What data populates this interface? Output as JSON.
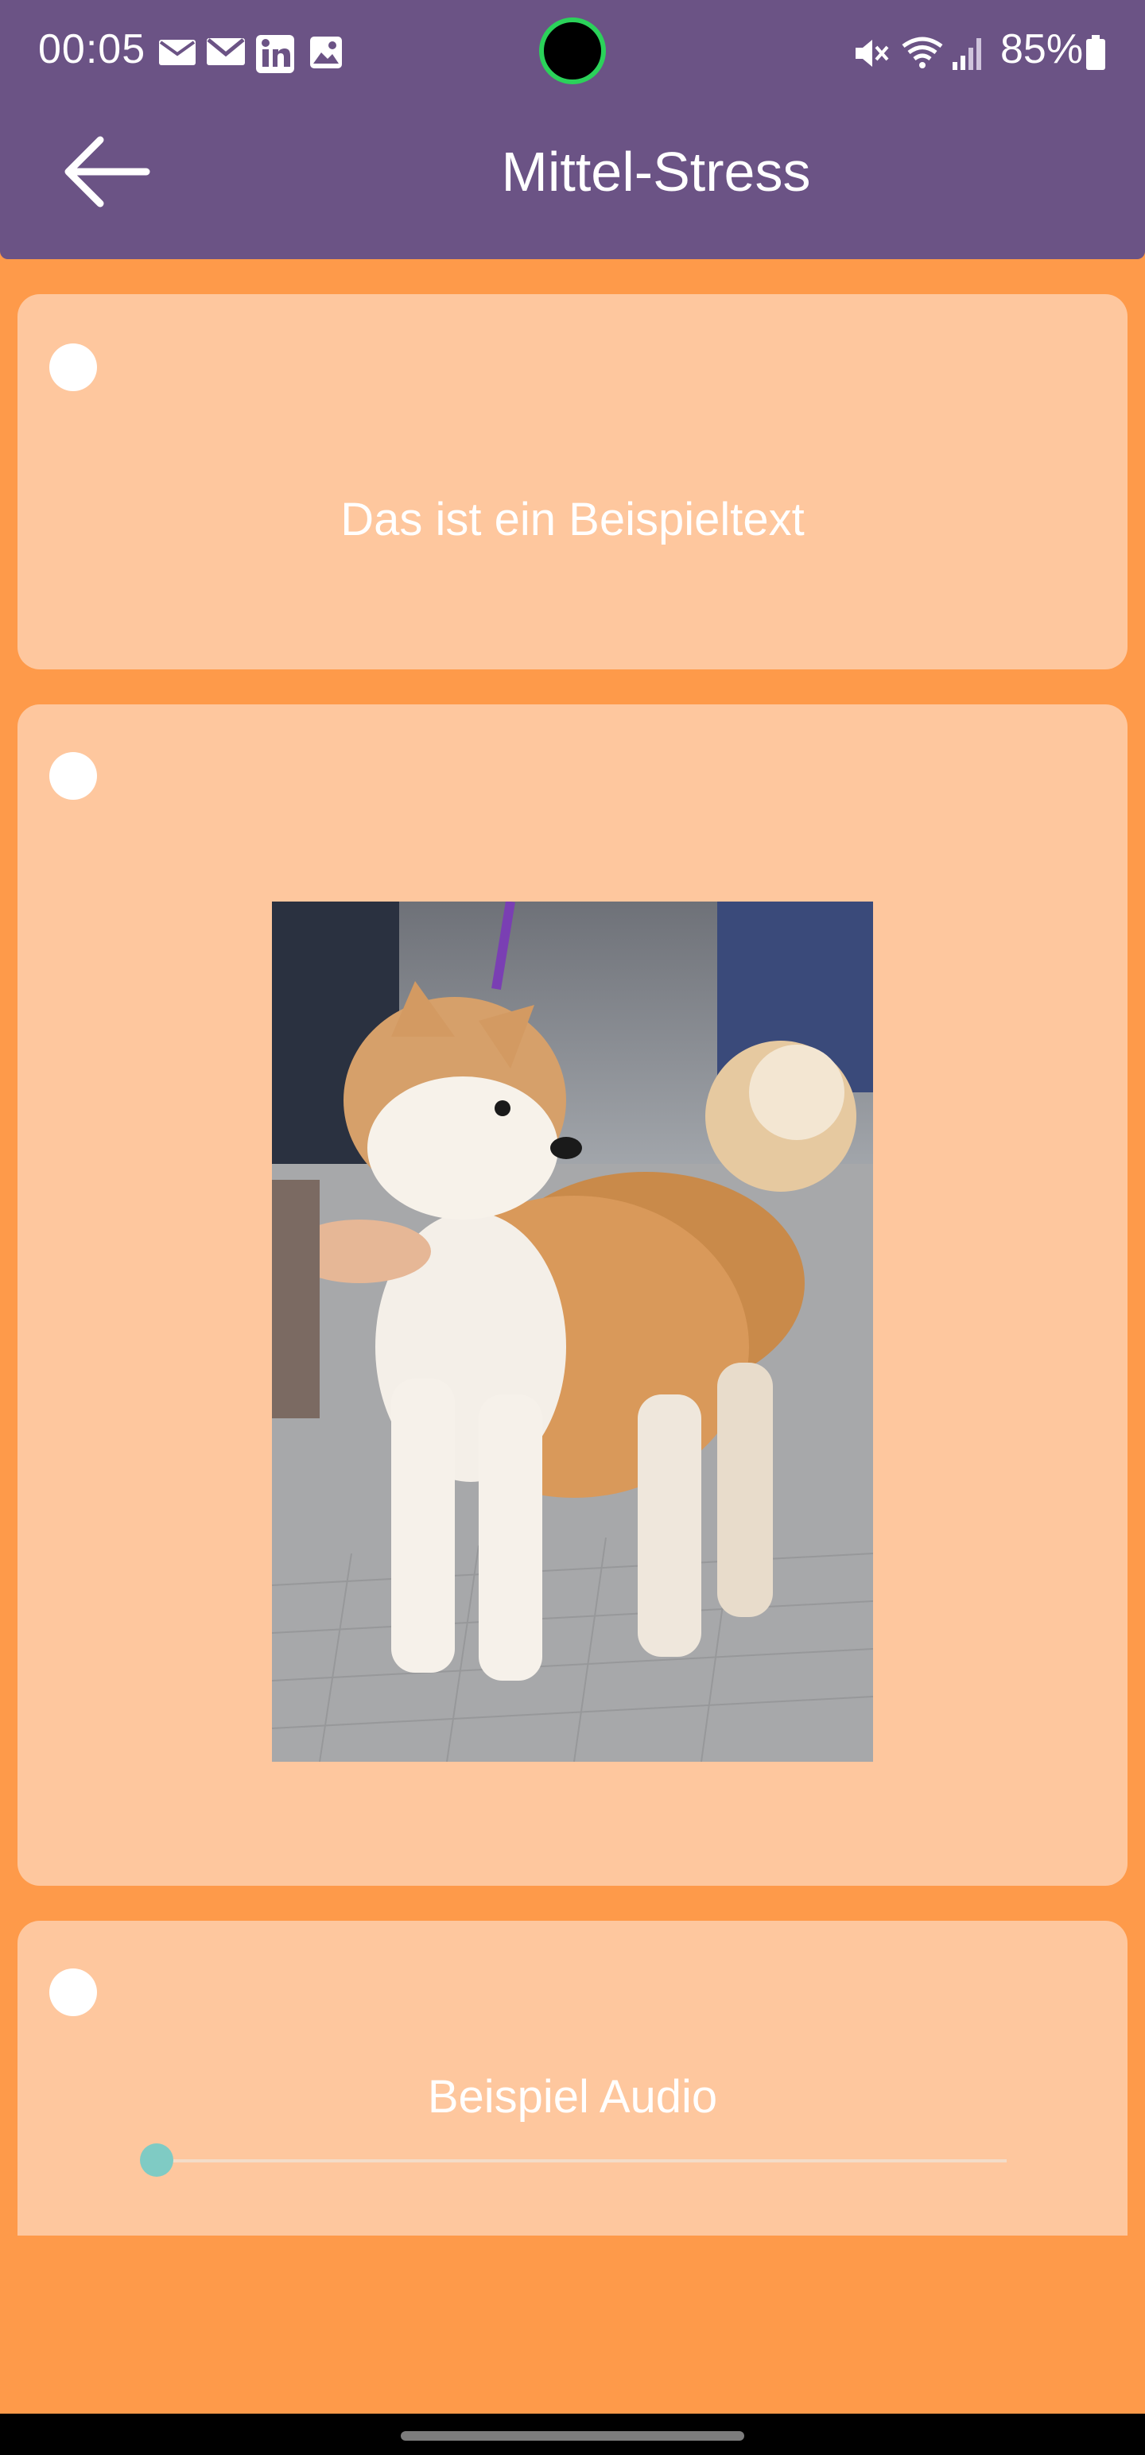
{
  "status_bar": {
    "time": "00:05",
    "battery": "85%",
    "icons": [
      "message-icon",
      "gmail-icon",
      "linkedin-icon",
      "gallery-icon",
      "mute-icon",
      "wifi-icon",
      "signal-icon",
      "battery-icon"
    ]
  },
  "app_bar": {
    "title": "Mittel-Stress",
    "back_icon": "arrow-left-icon",
    "color": "#6b5385"
  },
  "colors": {
    "background": "#fe9a4a",
    "card": "#fec79e",
    "slider_thumb": "#7fcbc4"
  },
  "cards": [
    {
      "type": "text",
      "text": "Das ist ein Beispieltext",
      "selected": false
    },
    {
      "type": "image",
      "alt": "Akita-Welpe an der Leine",
      "selected": false
    },
    {
      "type": "audio",
      "label": "Beispiel Audio",
      "progress": 0,
      "selected": false
    }
  ]
}
